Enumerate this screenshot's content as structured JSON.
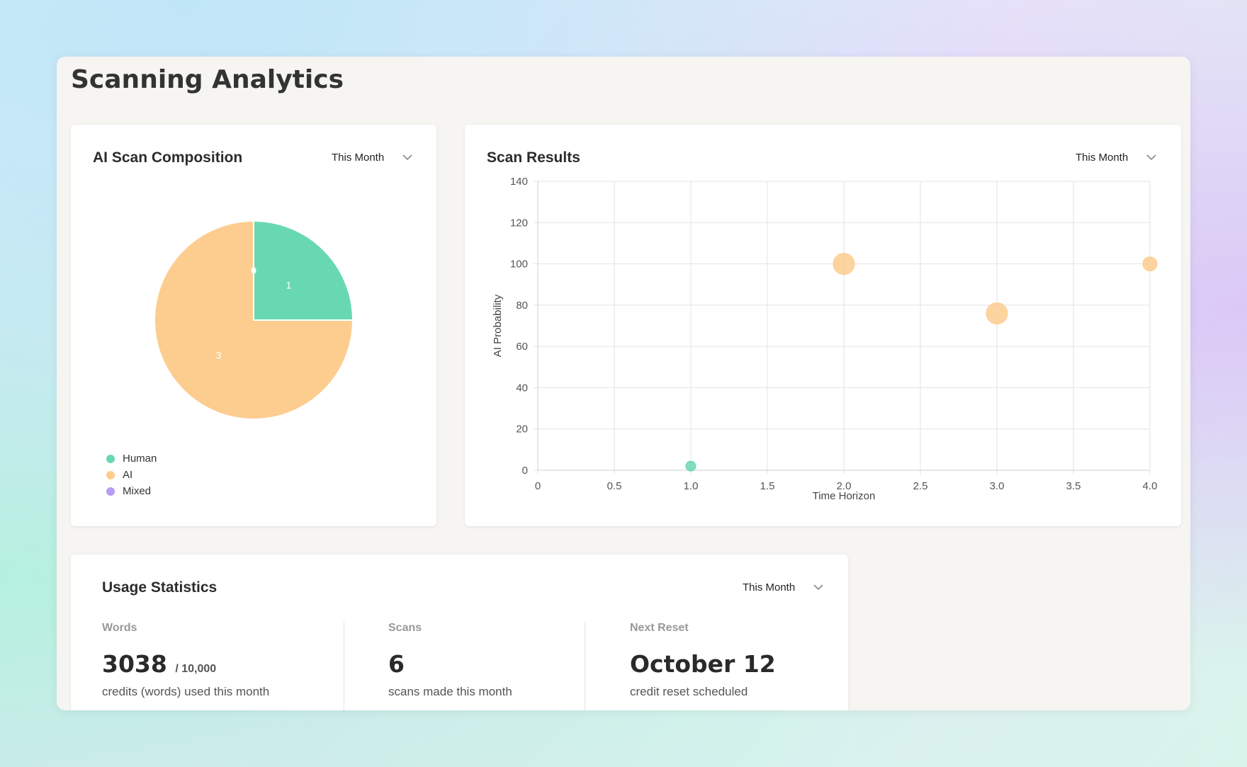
{
  "page": {
    "title": "Scanning Analytics"
  },
  "colors": {
    "human": "#68d8b2",
    "ai": "#fdcd8f",
    "mixed": "#b69cf5"
  },
  "composition_card": {
    "title": "AI Scan Composition",
    "period": "This Month",
    "legend": [
      {
        "label": "Human",
        "color": "#68d8b2"
      },
      {
        "label": "AI",
        "color": "#fdcd8f"
      },
      {
        "label": "Mixed",
        "color": "#b69cf5"
      }
    ]
  },
  "scan_card": {
    "title": "Scan Results",
    "period": "This Month"
  },
  "usage_card": {
    "title": "Usage Statistics",
    "period": "This Month",
    "words": {
      "label": "Words",
      "value": "3038",
      "limit": "/ 10,000",
      "desc": "credits (words) used this month"
    },
    "scans": {
      "label": "Scans",
      "value": "6",
      "desc": "scans made this month"
    },
    "reset": {
      "label": "Next Reset",
      "value": "October 12",
      "desc": "credit reset scheduled"
    }
  },
  "chart_data": [
    {
      "type": "pie",
      "labels": [
        "Human",
        "AI",
        "Mixed"
      ],
      "values": [
        1,
        3,
        0
      ],
      "colors": [
        "#68d8b2",
        "#fdcd8f",
        "#b69cf5"
      ],
      "legend": "bottom-left"
    },
    {
      "type": "scatter",
      "xlabel": "Time Horizon",
      "ylabel": "AI Probability",
      "xlim": [
        0,
        4
      ],
      "ylim": [
        0,
        140
      ],
      "xticks": [
        "0",
        "0.5",
        "1.0",
        "1.5",
        "2.0",
        "2.5",
        "3.0",
        "3.5",
        "4.0"
      ],
      "yticks": [
        "0",
        "20",
        "40",
        "60",
        "80",
        "100",
        "120",
        "140"
      ],
      "grid": true,
      "points": [
        {
          "x": 1.0,
          "y": 2,
          "r": 7,
          "category": "Human"
        },
        {
          "x": 2.0,
          "y": 100,
          "r": 15,
          "category": "AI"
        },
        {
          "x": 3.0,
          "y": 76,
          "r": 15,
          "category": "AI"
        },
        {
          "x": 4.0,
          "y": 100,
          "r": 10,
          "category": "AI"
        }
      ]
    }
  ]
}
